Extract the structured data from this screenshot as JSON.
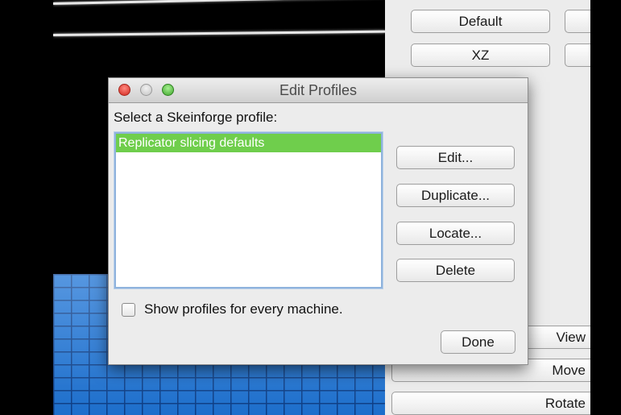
{
  "panel": {
    "default_label": "Default",
    "xz_label": "XZ",
    "view_label": "View",
    "move_label": "Move",
    "rotate_label": "Rotate"
  },
  "dialog": {
    "title": "Edit Profiles",
    "prompt": "Select a Skeinforge profile:",
    "profiles": [
      "Replicator slicing defaults"
    ],
    "selected_profile": "Replicator slicing defaults",
    "buttons": {
      "edit": "Edit...",
      "duplicate": "Duplicate...",
      "locate": "Locate...",
      "delete": "Delete"
    },
    "show_all_checkbox": {
      "label": "Show profiles for every machine.",
      "checked": false
    },
    "done_label": "Done"
  },
  "colors": {
    "selection": "#6fce4c",
    "build_plate": "#1e74d6",
    "close_button": "#d2281f",
    "zoom_button": "#3fa52c"
  }
}
